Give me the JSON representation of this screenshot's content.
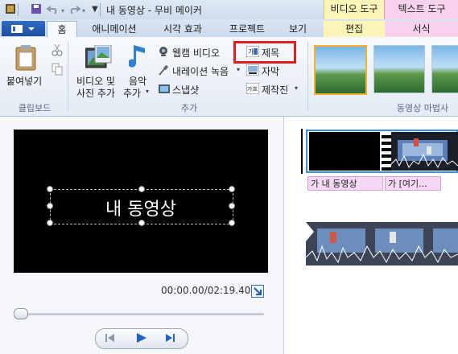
{
  "app": {
    "window_title": "내 동영상 - 무비 메이커",
    "context_tabs": {
      "video_tools": "비디오 도구",
      "text_tools": "텍스트 도구"
    }
  },
  "tabs": [
    {
      "label": "홈"
    },
    {
      "label": "애니메이션"
    },
    {
      "label": "시각 효과"
    },
    {
      "label": "프로젝트"
    },
    {
      "label": "보기"
    },
    {
      "label": "편집"
    },
    {
      "label": "서식"
    }
  ],
  "ribbon": {
    "clipboard": {
      "paste_label": "붙여넣기",
      "group_label": "클립보드"
    },
    "add": {
      "add_videos_photos": "비디오 및\n사진 추가",
      "add_videos_line1": "비디오 및",
      "add_videos_line2": "사진 추가",
      "add_music_line1": "음악",
      "add_music_line2": "추가",
      "webcam_video": "웹캠 비디오",
      "record_narration": "내레이션 녹음",
      "snapshot": "스냅샷",
      "title": "제목",
      "caption": "자막",
      "credits": "제작진",
      "group_label": "추가"
    },
    "themes_group_label": "동영상 마법사"
  },
  "preview": {
    "caption_text": "내 동영상",
    "time_display": "00:00.00/02:19.40"
  },
  "storyboard": {
    "caption_tags": [
      "가 내 동영상",
      "가 [여기..."
    ]
  },
  "colors": {
    "highlight_box": "#e02020",
    "video_tools_tab": "#fbf6b8",
    "text_tools_tab": "#f8d2ec",
    "selection": "#3c8fd9"
  }
}
